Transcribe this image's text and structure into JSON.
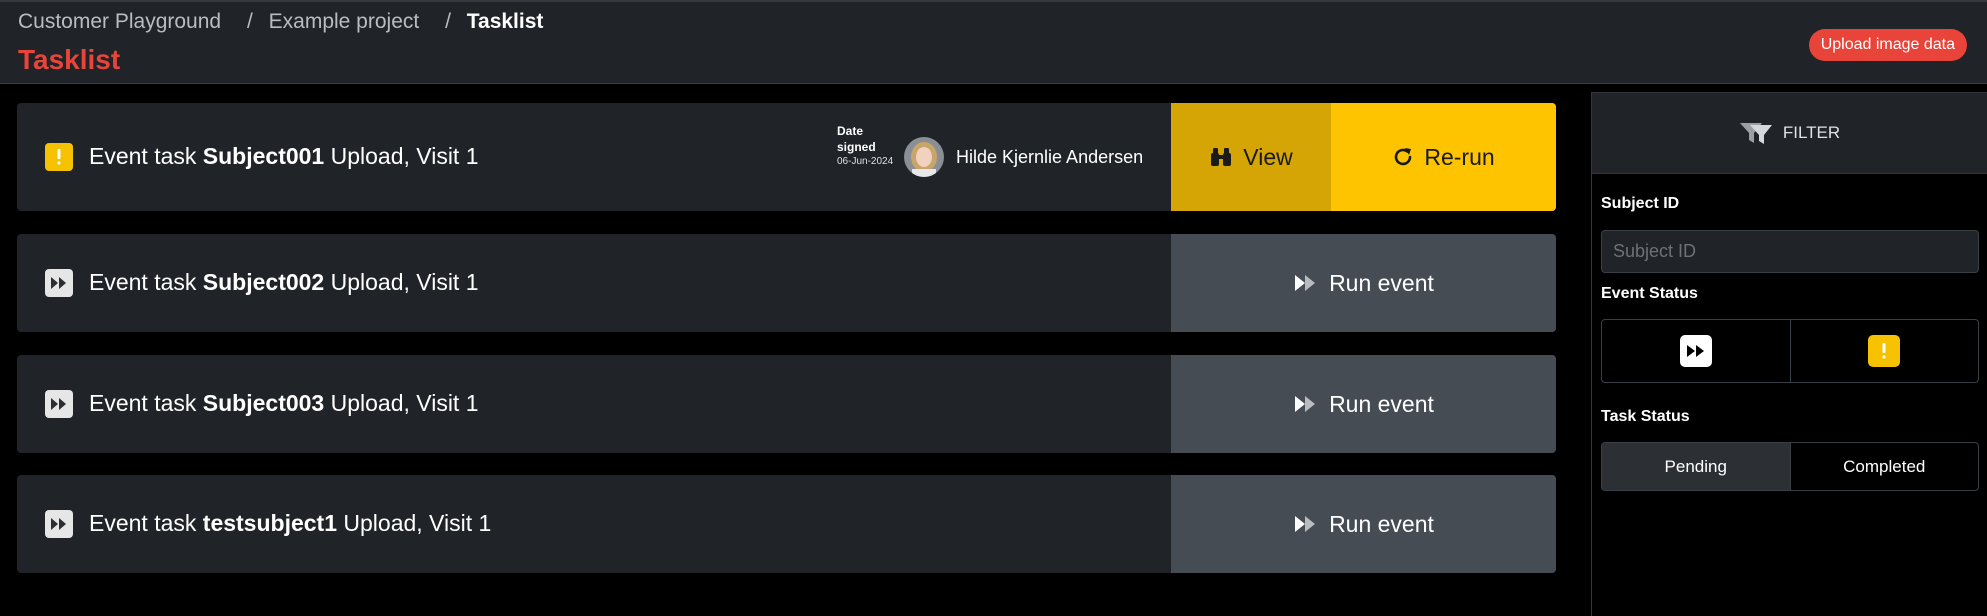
{
  "header": {
    "breadcrumb": [
      "Customer Playground",
      "Example project",
      "Tasklist"
    ],
    "separator": "/",
    "title": "Tasklist",
    "upload_label": "Upload image data"
  },
  "tasks": [
    {
      "status_icon": "exclamation-icon",
      "prefix": "Event task",
      "subject": "Subject001",
      "suffix": "Upload, Visit 1",
      "date_label": "Date signed",
      "date_value": "06-Jun-2024",
      "signer": "Hilde Kjernlie Andersen",
      "view_label": "View",
      "rerun_label": "Re-run"
    },
    {
      "status_icon": "fast-forward-icon",
      "prefix": "Event task",
      "subject": "Subject002",
      "suffix": "Upload, Visit 1",
      "run_label": "Run event"
    },
    {
      "status_icon": "fast-forward-icon",
      "prefix": "Event task",
      "subject": "Subject003",
      "suffix": "Upload, Visit 1",
      "run_label": "Run event"
    },
    {
      "status_icon": "fast-forward-icon",
      "prefix": "Event task",
      "subject": "testsubject1",
      "suffix": "Upload, Visit 1",
      "run_label": "Run event"
    }
  ],
  "filter": {
    "title": "FILTER",
    "subject_label": "Subject ID",
    "subject_placeholder": "Subject ID",
    "subject_value": "",
    "event_status_label": "Event Status",
    "event_status_options": [
      "fast-forward-icon",
      "exclamation-icon"
    ],
    "task_status_label": "Task Status",
    "task_status_options": [
      "Pending",
      "Completed"
    ],
    "task_status_selected": "Pending"
  },
  "colors": {
    "accent_red": "#e8443a",
    "warning_yellow": "#f6c200",
    "view_yellow": "#d4a504",
    "rerun_yellow": "#ffc400",
    "run_gray": "#464c54",
    "card_bg": "#202327"
  }
}
